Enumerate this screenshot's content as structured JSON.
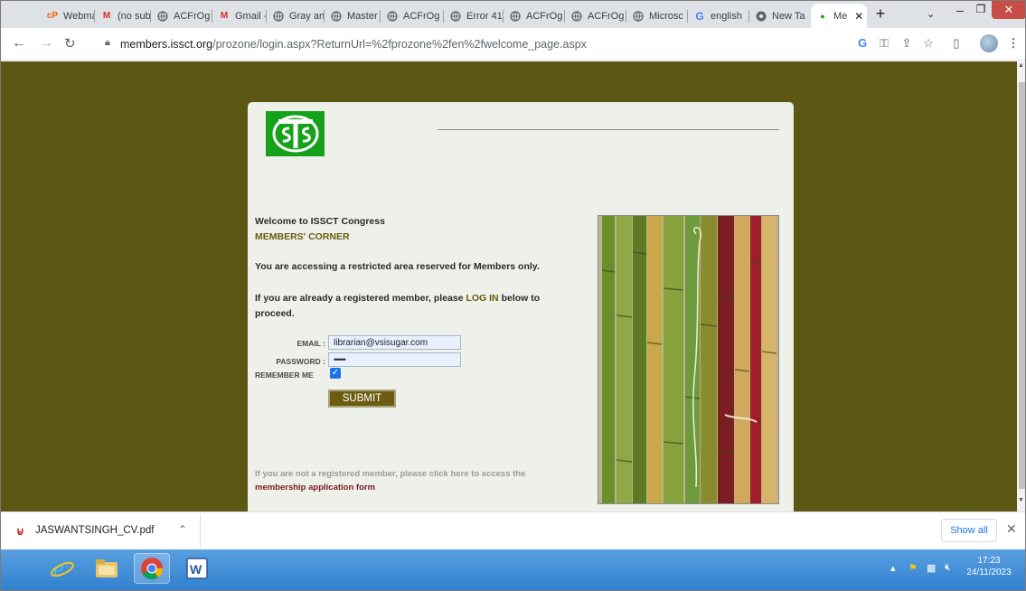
{
  "browser": {
    "tabs": [
      {
        "label": "Webma",
        "icon": "cpanel-icon"
      },
      {
        "label": "(no sub",
        "icon": "gmail-icon"
      },
      {
        "label": "ACFrOg",
        "icon": "globe-icon"
      },
      {
        "label": "Gmail -",
        "icon": "gmail-icon"
      },
      {
        "label": "Gray an",
        "icon": "globe-icon"
      },
      {
        "label": "Master",
        "icon": "globe-icon"
      },
      {
        "label": "ACFrOg",
        "icon": "globe-icon"
      },
      {
        "label": "Error 41",
        "icon": "globe-icon"
      },
      {
        "label": "ACFrOg",
        "icon": "globe-icon"
      },
      {
        "label": "ACFrOg",
        "icon": "globe-icon"
      },
      {
        "label": "Microsc",
        "icon": "globe-icon"
      },
      {
        "label": "english",
        "icon": "google-icon"
      },
      {
        "label": "New Ta",
        "icon": "chrome-icon"
      },
      {
        "label": "Me",
        "icon": "issct-icon",
        "active": true
      }
    ],
    "url_host": "members.issct.org",
    "url_path": "/prozone/login.aspx?ReturnUrl=%2fprozone%2fen%2fwelcome_page.aspx"
  },
  "page": {
    "welcome": "Welcome to ISSCT Congress",
    "members_corner": "MEMBERS' CORNER",
    "restricted": "You are accessing a restricted area reserved for Members only.",
    "already_prefix": "If you are already a registered member, please",
    "login_word": "LOG IN",
    "already_suffix": "below to proceed.",
    "email_label": "EMAIL :",
    "email_value": "librarian@vsisugar.com",
    "password_label": "PASSWORD :",
    "password_value": "••••••",
    "remember_label": "REMEMBER ME",
    "remember_checked": true,
    "submit_label": "SUBMIT",
    "not_registered": "If you are not a registered member, please click here to access the",
    "membership_link": "membership application form",
    "colors": {
      "page_bg": "#5c5713",
      "panel_bg": "#eef0ea",
      "button_bg": "#6b5c12",
      "link": "#7a1820"
    }
  },
  "downloads": {
    "file_name": "JASWANTSINGH_CV.pdf",
    "show_all": "Show all"
  },
  "taskbar": {
    "time": "17:23",
    "date": "24/11/2023"
  }
}
